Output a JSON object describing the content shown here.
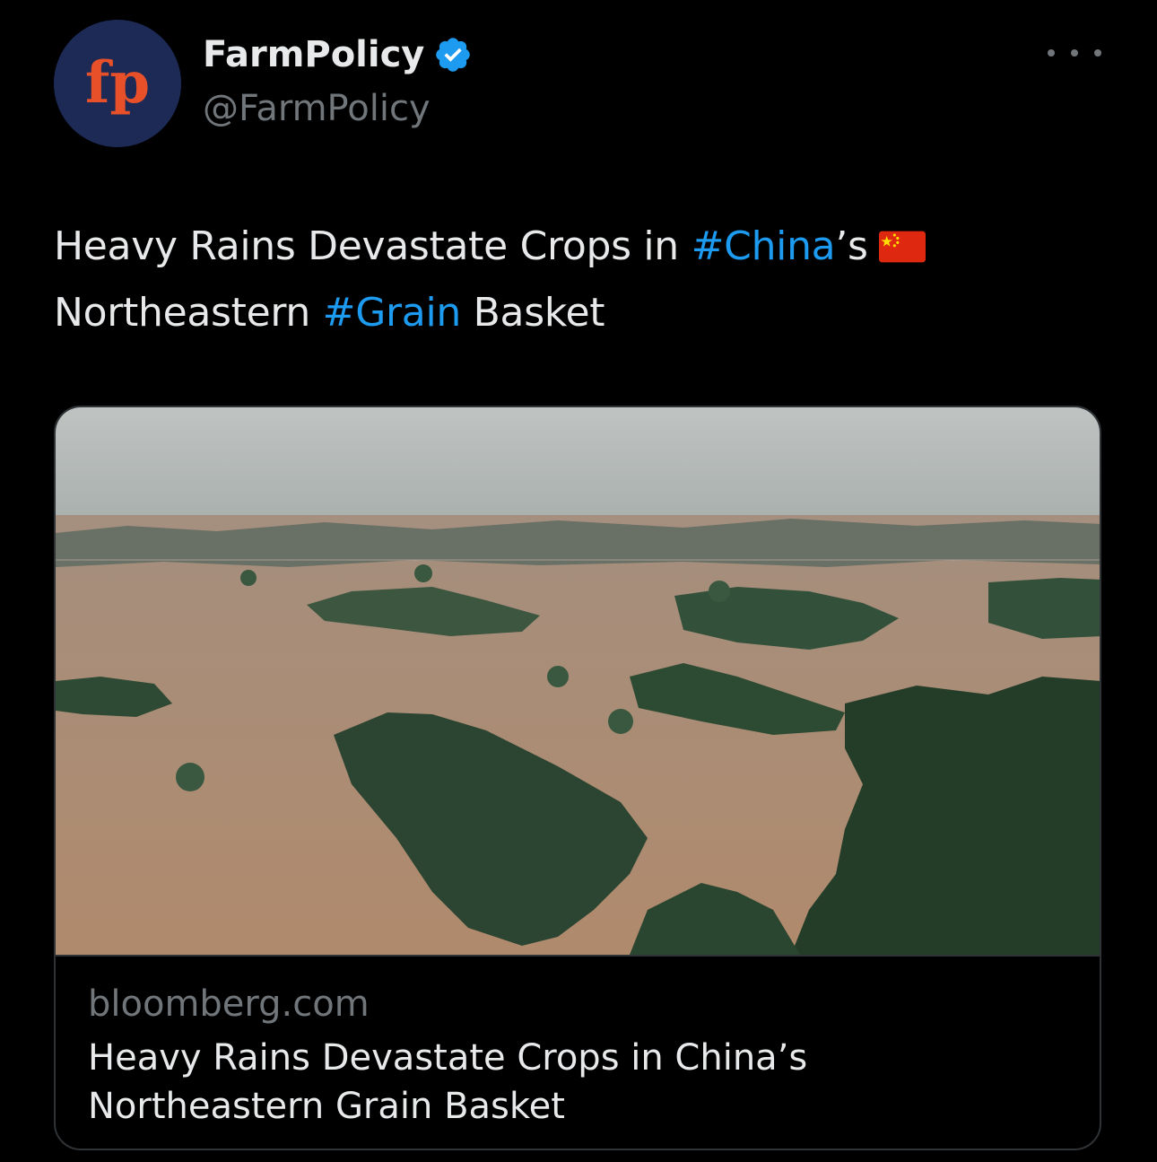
{
  "author": {
    "display_name": "FarmPolicy",
    "handle": "@FarmPolicy",
    "avatar_text": "fp",
    "verified": true
  },
  "tweet": {
    "text_part1": "Heavy Rains Devastate Crops in ",
    "hashtag1": "#China",
    "text_part2": "’s",
    "text_part3": "Northeastern ",
    "hashtag2": "#Grain",
    "text_part4": " Basket",
    "flag_icon": "china-flag-icon"
  },
  "card": {
    "domain": "bloomberg.com",
    "title_line1": "Heavy Rains Devastate Crops in China’s",
    "title_line2": "Northeastern Grain Basket"
  },
  "colors": {
    "background": "#000000",
    "text": "#e7e9ea",
    "secondary": "#71767b",
    "link": "#1d9bf0",
    "avatar_bg": "#1d2a55",
    "avatar_text": "#e8502a",
    "verified": "#1d9bf0"
  }
}
